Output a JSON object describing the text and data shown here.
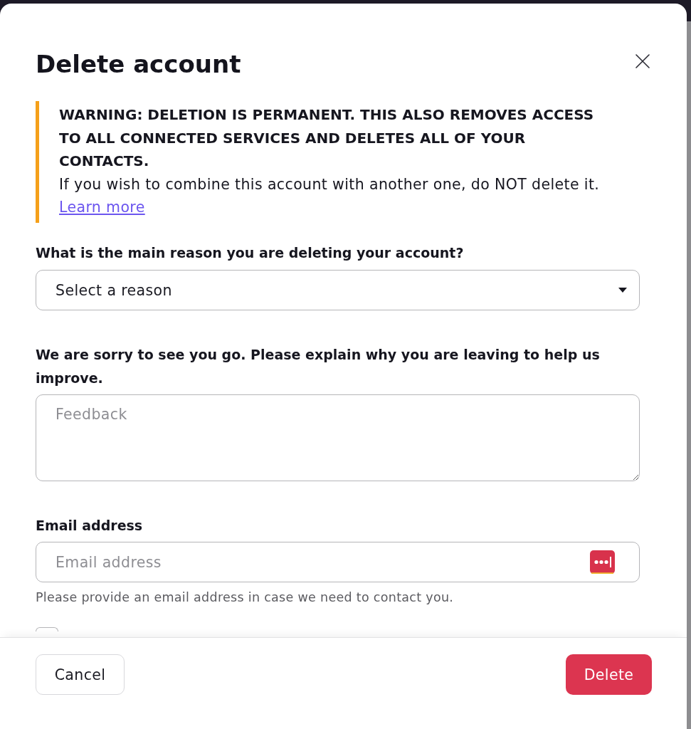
{
  "dialog": {
    "title": "Delete account"
  },
  "warning": {
    "heading": "WARNING: DELETION IS PERMANENT. THIS ALSO REMOVES ACCESS TO ALL CONNECTED SERVICES AND DELETES ALL OF YOUR CONTACTS.",
    "text": "If you wish to combine this account with another one, do NOT delete it.",
    "link": "Learn more"
  },
  "fields": [
    {
      "kind": "select",
      "label": "What is the main reason you are deleting your account?",
      "value": "Select a reason"
    },
    {
      "kind": "textarea",
      "label": "We are sorry to see you go. Please explain why you are leaving to help us improve.",
      "placeholder": "Feedback"
    },
    {
      "kind": "email",
      "label": "Email address",
      "placeholder": "Email address",
      "help": "Please provide an email address in case we need to contact you."
    }
  ],
  "consent_checkbox": {
    "checked": false
  },
  "buttons": [
    {
      "label": "Cancel",
      "kind": "secondary"
    },
    {
      "label": "Delete",
      "kind": "danger"
    }
  ]
}
